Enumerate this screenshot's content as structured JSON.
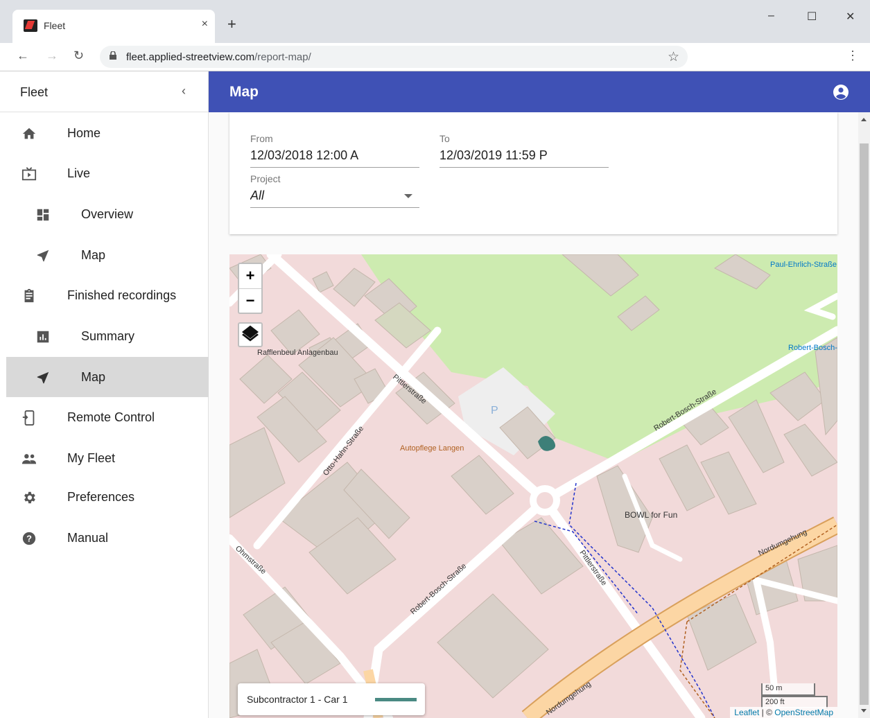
{
  "browser": {
    "tab_title": "Fleet",
    "tab_close": "×",
    "new_tab": "+",
    "url_host": "fleet.applied-streetview.com",
    "url_path": "/report-map/",
    "window_controls": [
      "–",
      "☐",
      "✕"
    ]
  },
  "sidebar": {
    "brand": "Fleet",
    "items": [
      {
        "label": "Home",
        "icon": "home-icon"
      },
      {
        "label": "Live",
        "icon": "tv-icon"
      },
      {
        "label": "Overview",
        "icon": "dashboard-icon"
      },
      {
        "label": "Map",
        "icon": "navigation-icon"
      },
      {
        "label": "Finished recordings",
        "icon": "clipboard-icon"
      },
      {
        "label": "Summary",
        "icon": "chart-icon"
      },
      {
        "label": "Map",
        "icon": "navigation-icon",
        "active": true
      },
      {
        "label": "Remote Control",
        "icon": "phone-icon"
      },
      {
        "label": "My Fleet",
        "icon": "people-icon"
      },
      {
        "label": "Preferences",
        "icon": "gear-icon"
      },
      {
        "label": "Manual",
        "icon": "help-icon"
      }
    ]
  },
  "appbar": {
    "title": "Map"
  },
  "filters": {
    "from_label": "From",
    "from_value": "12/03/2018 12:00 A",
    "to_label": "To",
    "to_value": "12/03/2019 11:59 P",
    "project_label": "Project",
    "project_value": "All"
  },
  "map": {
    "zoom_in": "+",
    "zoom_out": "−",
    "legend_label": "Subcontractor 1 - Car 1",
    "legend_color": "#4a8a83",
    "scale_m": "50 m",
    "scale_ft": "200 ft",
    "attribution_leaflet": "Leaflet",
    "attribution_sep": " | © ",
    "attribution_osm": "OpenStreetMap",
    "labels": {
      "pittlerstrasse": "Pittlerstraße",
      "pittlerstrasse2": "Pittlerstraße",
      "robert_bosch_1": "Robert-Bosch-Straße",
      "robert_bosch_2": "Robert-Bosch-Straße",
      "otto_hahn": "Otto-Hahn-Straße",
      "ohmstrasse": "Ohmstraße",
      "nordumgehung": "Nordumgehung",
      "nordumgehung2": "Nordumgehung",
      "paul_ehrlich": "Paul-Ehrlich-Straße",
      "robert_bosch_sued": "Robert-Bosch-Straße Süd",
      "rafflenbeul": "Rafflenbeul Anlagenbau",
      "autopflege": "Autopflege Langen",
      "bowl": "BOWL for Fun",
      "parking": "P"
    }
  }
}
